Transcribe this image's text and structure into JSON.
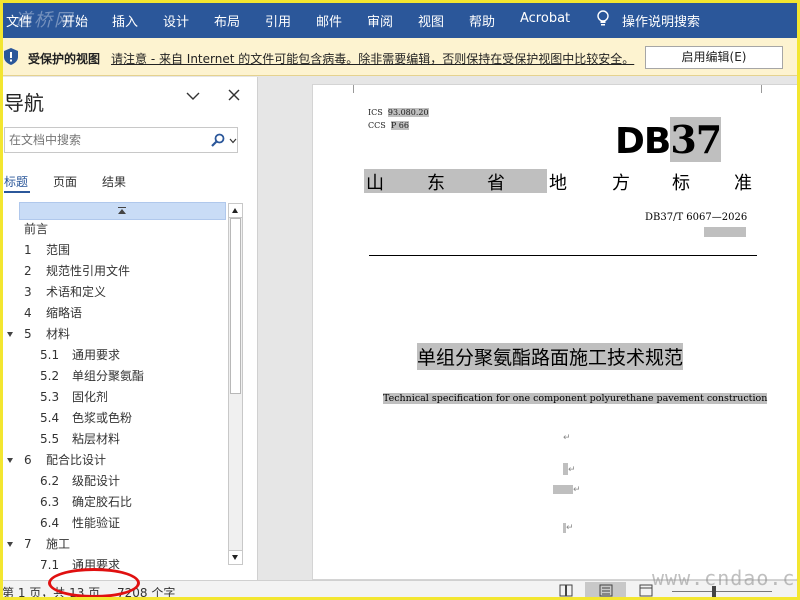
{
  "ribbon": {
    "watermark": "道桥网",
    "tabs": [
      "文件",
      "开始",
      "插入",
      "设计",
      "布局",
      "引用",
      "邮件",
      "审阅",
      "视图",
      "帮助",
      "Acrobat"
    ],
    "tell_me": "操作说明搜索",
    "background": "#2b579a"
  },
  "protected_view": {
    "title": "受保护的视图",
    "message": "请注意 - 来自 Internet 的文件可能包含病毒。除非需要编辑，否则保持在受保护视图中比较安全。",
    "enable_button": "启用编辑(E)",
    "icon": "shield-icon"
  },
  "nav_pane": {
    "title": "导航",
    "search_placeholder": "在文档中搜索",
    "tabs": [
      "标题",
      "页面",
      "结果"
    ],
    "active_tab": "标题",
    "items": [
      {
        "num": "",
        "label": "前言"
      },
      {
        "num": "1",
        "label": "范围"
      },
      {
        "num": "2",
        "label": "规范性引用文件"
      },
      {
        "num": "3",
        "label": "术语和定义"
      },
      {
        "num": "4",
        "label": "缩略语"
      },
      {
        "num": "5",
        "label": "材料"
      },
      {
        "num": "5.1",
        "label": "通用要求"
      },
      {
        "num": "5.2",
        "label": "单组分聚氨酯"
      },
      {
        "num": "5.3",
        "label": "固化剂"
      },
      {
        "num": "5.4",
        "label": "色浆或色粉"
      },
      {
        "num": "5.5",
        "label": "粘层材料"
      },
      {
        "num": "6",
        "label": "配合比设计"
      },
      {
        "num": "6.2",
        "label": "级配设计"
      },
      {
        "num": "6.3",
        "label": "确定胶石比"
      },
      {
        "num": "6.4",
        "label": "性能验证"
      },
      {
        "num": "7",
        "label": "施工"
      },
      {
        "num": "7.1",
        "label": "通用要求"
      }
    ]
  },
  "document": {
    "ics_label": "ICS",
    "ics_value": "93.080.20",
    "ccs_label": "CCS",
    "ccs_value": "P 66",
    "logo_prefix": "DB",
    "logo_number": "37",
    "standard_chars": [
      "山",
      "东",
      "省",
      "地",
      "方",
      "标",
      "准"
    ],
    "code": "DB37/T 6067—2026",
    "title_cn": "单组分聚氨酯路面施工技术规范",
    "title_en": "Technical specification for one component polyurethane pavement construction"
  },
  "status_bar": {
    "page_info": "第 1 页，共 13 页",
    "word_count": "7208 个字",
    "watermark": "www.cndao.com"
  }
}
